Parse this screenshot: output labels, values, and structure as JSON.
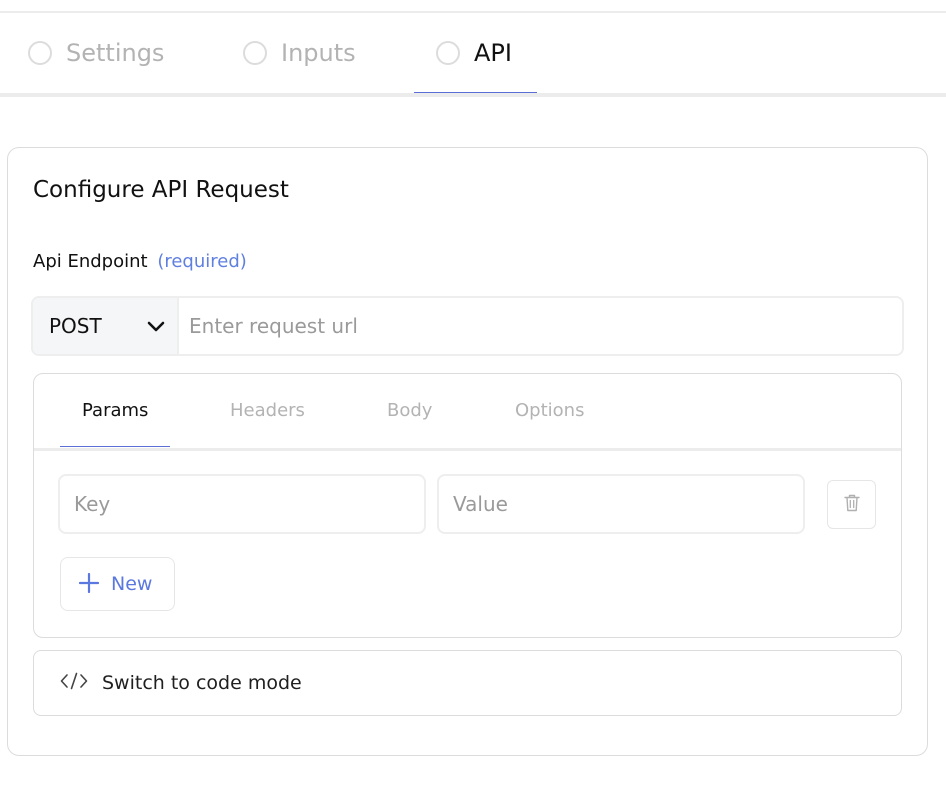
{
  "steps": [
    {
      "label": "Settings",
      "active": false
    },
    {
      "label": "Inputs",
      "active": false
    },
    {
      "label": "API",
      "active": true
    }
  ],
  "card": {
    "title": "Configure API Request",
    "endpoint_label": "Api Endpoint",
    "required_text": "(required)",
    "method": "POST",
    "url_placeholder": "Enter request url"
  },
  "request_tabs": [
    {
      "label": "Params",
      "active": true
    },
    {
      "label": "Headers",
      "active": false
    },
    {
      "label": "Body",
      "active": false
    },
    {
      "label": "Options",
      "active": false
    }
  ],
  "params": {
    "key_placeholder": "Key",
    "value_placeholder": "Value",
    "new_label": "New"
  },
  "code_mode_label": "Switch to code mode",
  "colors": {
    "accent": "#5b6fd6",
    "required": "#6080e0",
    "muted": "#b3b3b3",
    "border": "#dcdcdc"
  }
}
